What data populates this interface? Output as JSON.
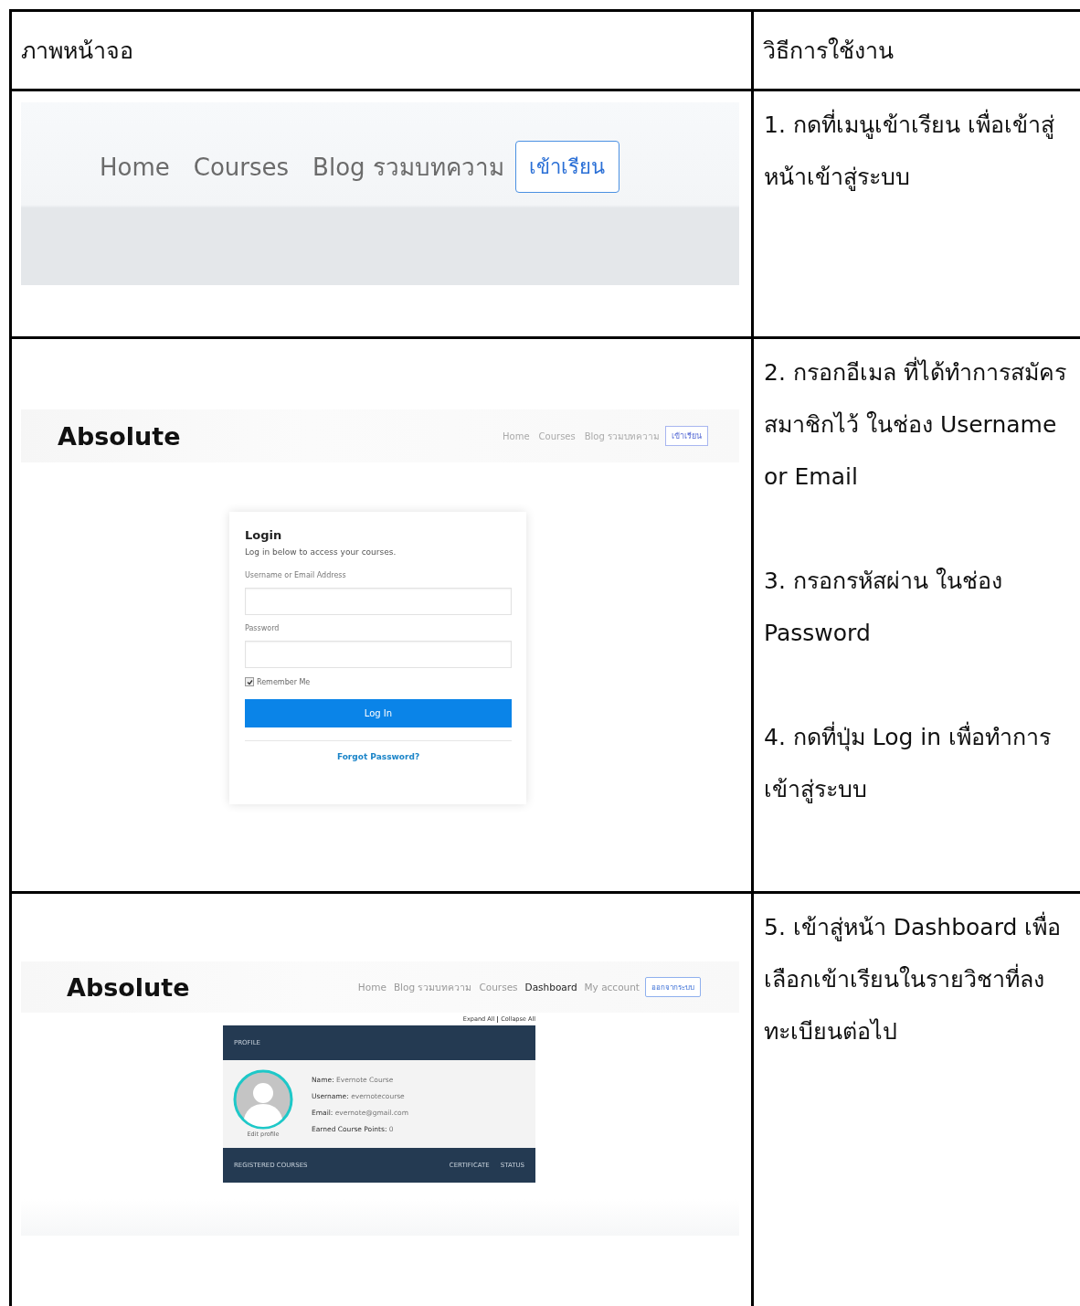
{
  "table": {
    "columns": [
      "ภาพหน้าจอ",
      "วิธีการใช้งาน"
    ],
    "rows": [
      {
        "screenshot": {
          "kind": "nav",
          "nav": [
            "Home",
            "Courses",
            "Blog รวมบทความ"
          ],
          "button": "เข้าเรียน"
        },
        "instructions": [
          "1. กดที่เมนูเข้าเรียน เพื่อเข้าสู่หน้าเข้าสู่ระบบ"
        ]
      },
      {
        "screenshot": {
          "kind": "login",
          "logo": "Absolute",
          "nav": [
            "Home",
            "Courses",
            "Blog รวมบทความ"
          ],
          "button": "เข้าเรียน",
          "title": "Login",
          "subtitle": "Log in below to access your courses.",
          "fields": [
            {
              "label": "Username or Email Address"
            },
            {
              "label": "Password"
            }
          ],
          "remember": {
            "label": "Remember Me",
            "checked": true
          },
          "submit": "Log In",
          "link": "Forgot Password?"
        },
        "instructions": [
          "2. กรอกอีเมล ที่ได้ทำการสมัครสมาชิกไว้ ในช่อง Username or Email",
          "3. กรอกรหัสผ่าน ในช่อง Password",
          "4. กดที่ปุ่ม Log in เพื่อทำการเข้าสู่ระบบ"
        ]
      },
      {
        "screenshot": {
          "kind": "dashboard",
          "logo": "Absolute",
          "nav": [
            {
              "label": "Home",
              "selected": false
            },
            {
              "label": "Blog รวมบทความ",
              "selected": false
            },
            {
              "label": "Courses",
              "selected": false
            },
            {
              "label": "Dashboard",
              "selected": true
            },
            {
              "label": "My account",
              "selected": false
            }
          ],
          "button": "ออกจากระบบ",
          "expand": "Expand All",
          "collapse": "Collapse All",
          "profile_title": "PROFILE",
          "edit": "Edit profile",
          "info": [
            {
              "key": "Name:",
              "value": "Evernote Course"
            },
            {
              "key": "Username:",
              "value": "evernotecourse"
            },
            {
              "key": "Email:",
              "value": "evernote@gmail.com"
            },
            {
              "key": "Earned Course Points:",
              "value": "0"
            }
          ],
          "courses_bar": [
            "REGISTERED COURSES",
            "CERTIFICATE",
            "STATUS"
          ]
        },
        "instructions": [
          "5. เข้าสู่หน้า Dashboard เพื่อเลือกเข้าเรียนในรายวิชาที่ลงทะเบียนต่อไป"
        ]
      }
    ]
  }
}
